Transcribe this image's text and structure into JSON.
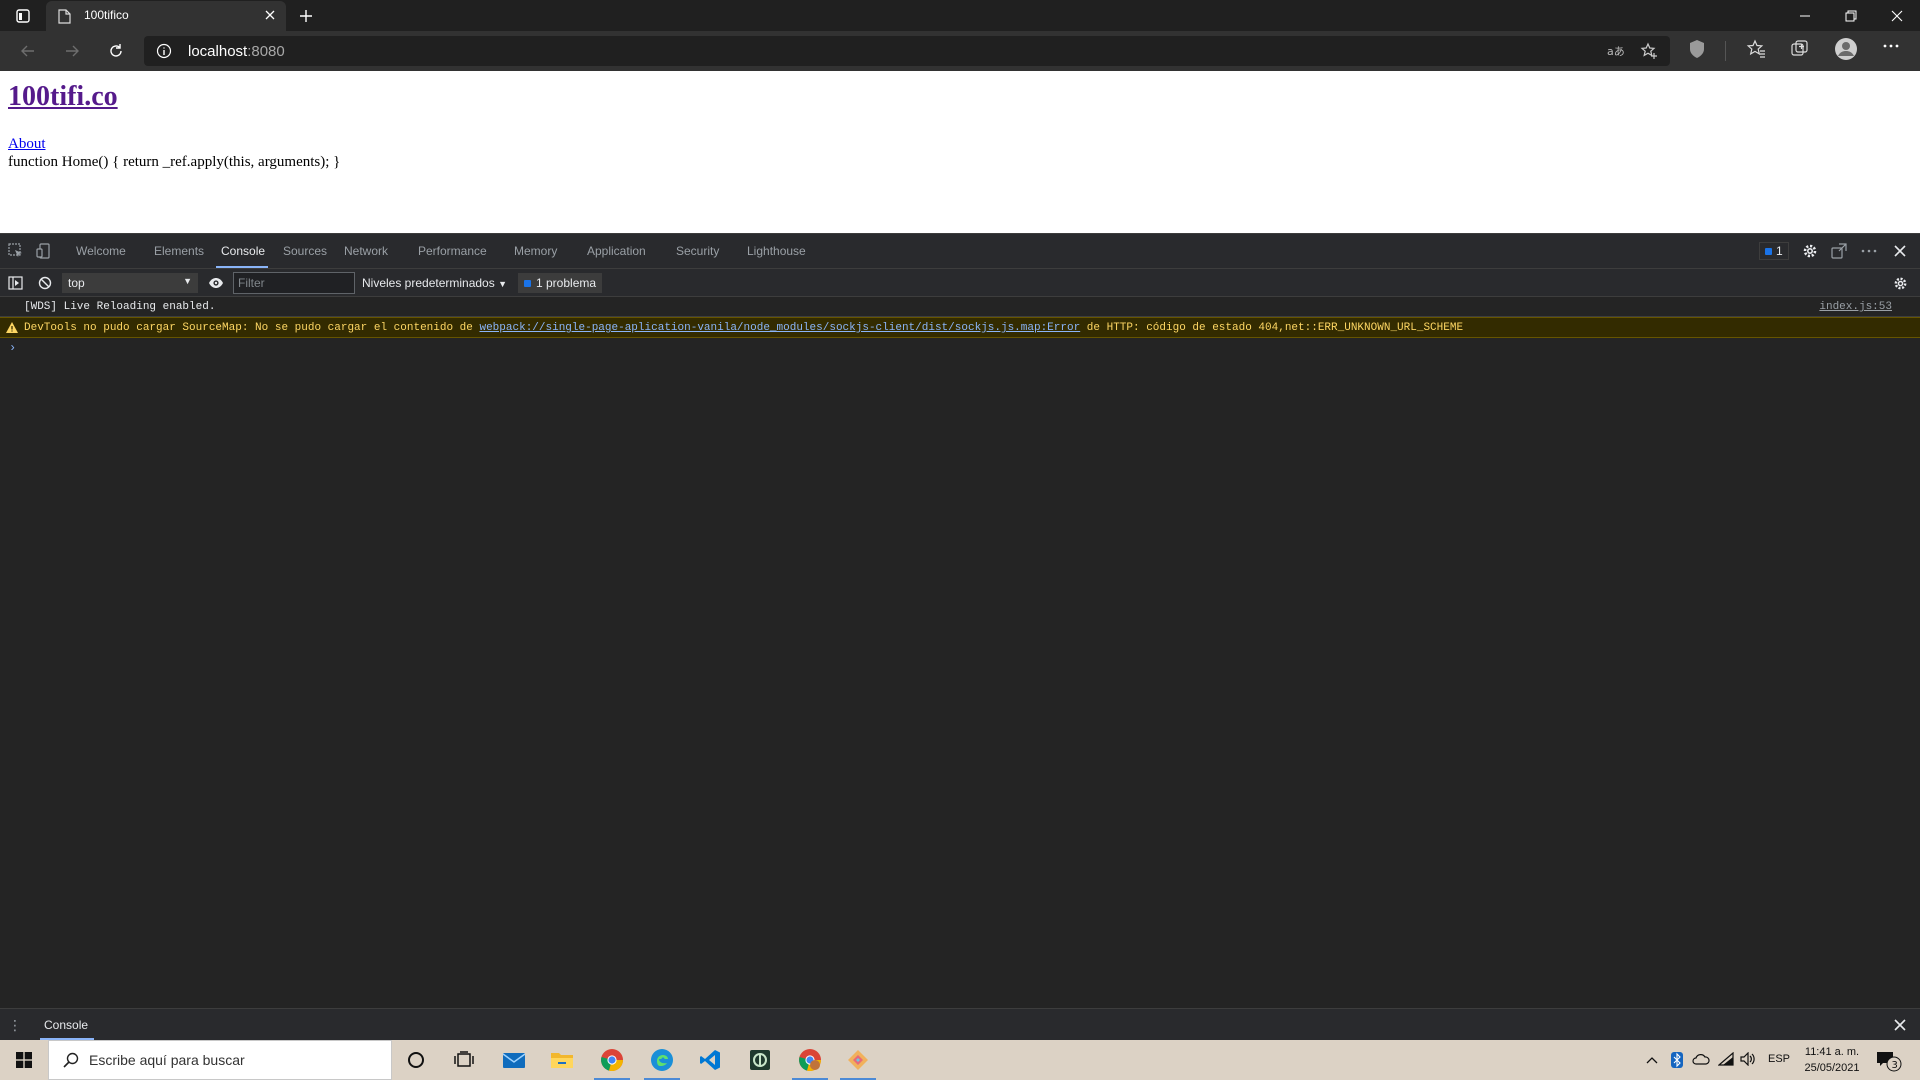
{
  "browser": {
    "tab_title": "100tifico",
    "url_host": "localhost",
    "url_port": ":8080"
  },
  "page": {
    "site_title": "100tifi.co",
    "nav_link": "About",
    "body_text": "function Home() { return _ref.apply(this, arguments); }"
  },
  "devtools": {
    "tabs": [
      "Welcome",
      "Elements",
      "Console",
      "Sources",
      "Network",
      "Performance",
      "Memory",
      "Application",
      "Security",
      "Lighthouse"
    ],
    "active_tab": "Console",
    "issues_count": "1",
    "context": "top",
    "filter_placeholder": "Filter",
    "levels_label": "Niveles predeterminados",
    "issues_label": "1 problema",
    "messages": [
      {
        "type": "log",
        "text": "[WDS] Live Reloading enabled.",
        "source": "index.js:53"
      },
      {
        "type": "warning",
        "prefix": "DevTools no pudo cargar SourceMap: No se pudo cargar el contenido de ",
        "link": "webpack://single-page-aplication-vanila/node_modules/sockjs-client/dist/sockjs.js.map:Error",
        "suffix": " de HTTP: código de estado 404,net::ERR_UNKNOWN_URL_SCHEME"
      }
    ],
    "drawer_tab": "Console"
  },
  "taskbar": {
    "search_placeholder": "Escribe aquí para buscar",
    "language": "ESP",
    "time": "11:41 a. m.",
    "date": "25/05/2021",
    "notification_count": "3",
    "pinned_apps": [
      "cortana-icon",
      "task-view-icon",
      "mail-icon",
      "file-explorer-icon",
      "chrome-icon",
      "edge-icon",
      "vscode-icon",
      "cmder-icon",
      "chrome-profile-icon",
      "git-kraken-icon"
    ]
  },
  "colors": {
    "accent": "#8ab4f8",
    "warning_bg": "#332b00",
    "issue_blue": "#1a73e8"
  }
}
